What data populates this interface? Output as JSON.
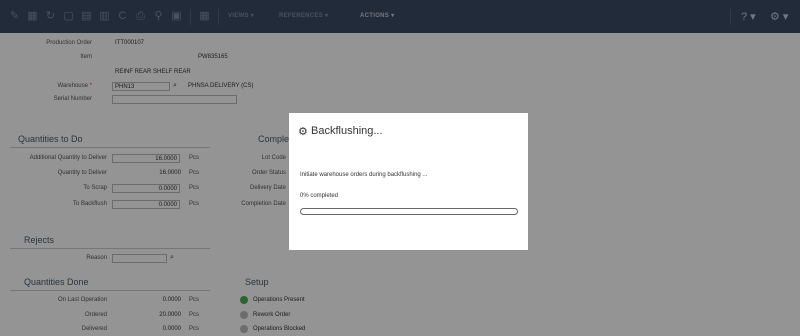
{
  "toolbar": {
    "icons": [
      "edit-icon",
      "calendar-icon",
      "refresh-icon",
      "copy-icon",
      "doc-icon",
      "doc2-icon",
      "undo-icon",
      "print-icon",
      "search-icon",
      "save-icon",
      "calendar2-icon"
    ],
    "menus": [
      {
        "label": "VIEWS ▾",
        "active": false
      },
      {
        "label": "REFERENCES ▾",
        "active": false
      },
      {
        "label": "ACTIONS ▾",
        "active": true
      }
    ],
    "help_label": "? ▾",
    "settings_label": "⚙ ▾"
  },
  "form": {
    "production_order_label": "Production Order",
    "production_order_value": "ITT000107",
    "item_label": "Item",
    "item_value": "PW835165",
    "item_description": "REINF REAR SHELF REAR",
    "warehouse_label": "Warehouse",
    "warehouse_required": "*",
    "warehouse_value": "PHN13",
    "warehouse_description": "PHNSA DELIVERY (CS)",
    "serial_label": "Serial Number"
  },
  "quantities_to_do": {
    "title": "Quantities to Do",
    "rows": [
      {
        "label": "Additional Quantity to Deliver",
        "value": "16.0000",
        "uom": "Pcs"
      },
      {
        "label": "Quantity to Deliver",
        "value": "16.0000",
        "uom": "Pcs"
      },
      {
        "label": "To Scrap",
        "value": "0.0000",
        "uom": "Pcs"
      },
      {
        "label": "To Backflush",
        "value": "0.0000",
        "uom": "Pcs"
      }
    ]
  },
  "completion": {
    "title": "Completion",
    "rows": [
      "Lot Code",
      "Order Status",
      "Delivery Date",
      "Completion Date"
    ]
  },
  "rejects": {
    "title": "Rejects",
    "reason_label": "Reason"
  },
  "quantities_done": {
    "title": "Quantities Done",
    "rows": [
      {
        "label": "On Last Operation",
        "value": "0.0000",
        "uom": "Pcs"
      },
      {
        "label": "Ordered",
        "value": "20.0000",
        "uom": "Pcs"
      },
      {
        "label": "Delivered",
        "value": "0.0000",
        "uom": "Pcs"
      }
    ]
  },
  "setup": {
    "title": "Setup",
    "rows": [
      {
        "label": "Operations Present",
        "checked": true
      },
      {
        "label": "Rework Order",
        "checked": false
      },
      {
        "label": "Operations Blocked",
        "checked": false
      }
    ]
  },
  "modal": {
    "title": "Backflushing...",
    "message": "Initiate warehouse orders during backflushing ...",
    "progress_text": "0% completed",
    "progress_percent": 0
  },
  "colors": {
    "toolbar": "#3a4a62",
    "accent": "#4a7fc0",
    "check_on": "#4caf50",
    "check_off": "#bbbbbb"
  }
}
